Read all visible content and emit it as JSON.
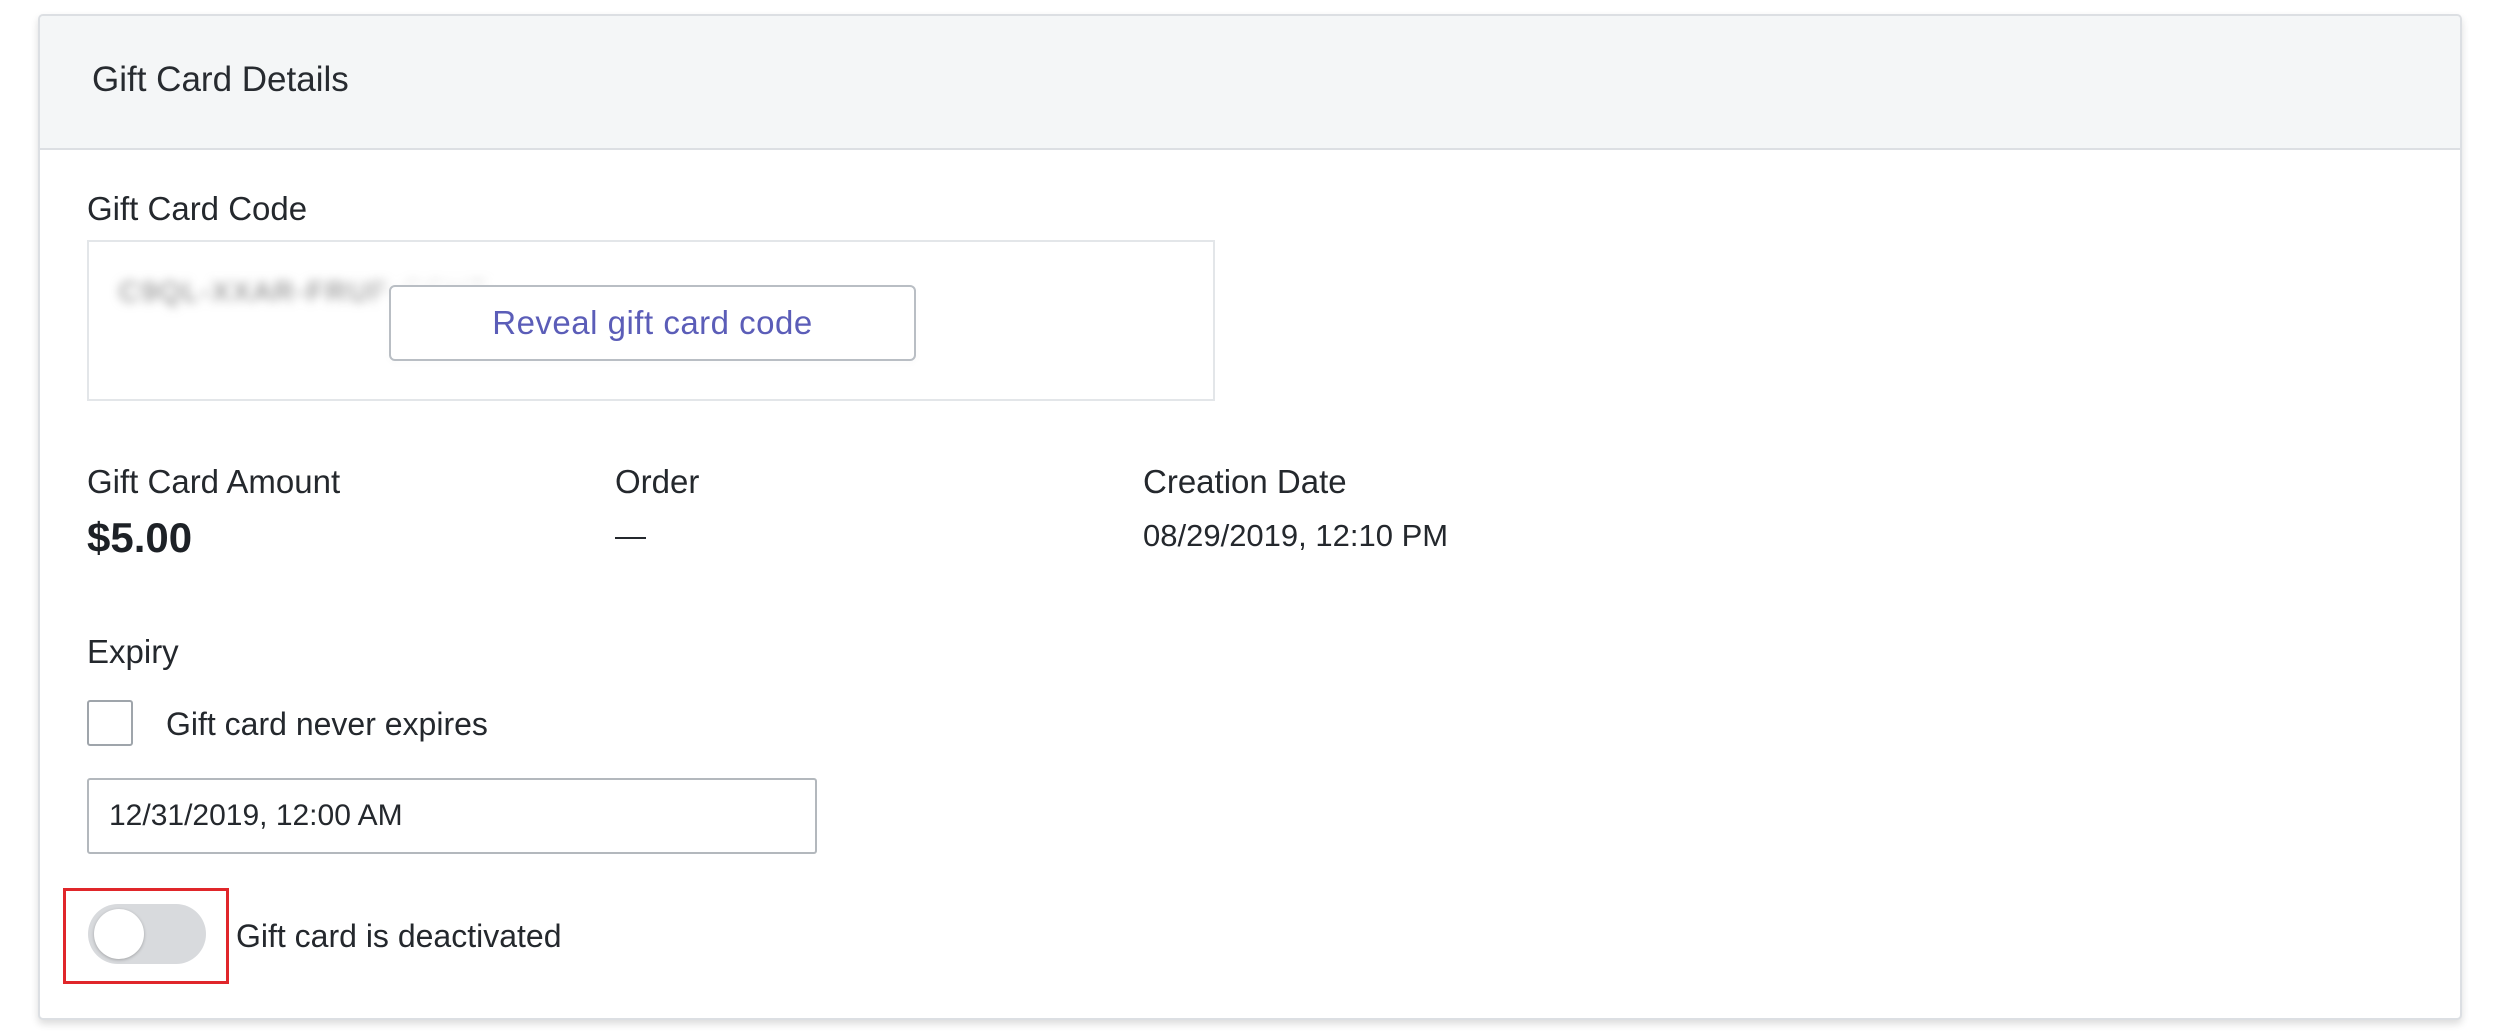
{
  "card": {
    "title": "Gift Card Details"
  },
  "code_section": {
    "label": "Gift Card Code",
    "masked_code": "C9QL-XXAR-FRUP-CCHT",
    "reveal_button_label": "Reveal gift card code"
  },
  "amount": {
    "label": "Gift Card Amount",
    "value": "$5.00"
  },
  "order": {
    "label": "Order",
    "value": "—"
  },
  "creation_date": {
    "label": "Creation Date",
    "value": "08/29/2019, 12:10 PM"
  },
  "expiry": {
    "label": "Expiry",
    "never_expires_label": "Gift card never expires",
    "never_expires_checked": false,
    "date_value": "12/31/2019, 12:00 AM"
  },
  "activation": {
    "toggle_label": "Gift card is deactivated",
    "toggle_on": false,
    "highlight_color": "#e0262a"
  },
  "colors": {
    "accent": "#5b5db8",
    "header_bg": "#f4f6f7",
    "toggle_off": "#d8dadd"
  }
}
